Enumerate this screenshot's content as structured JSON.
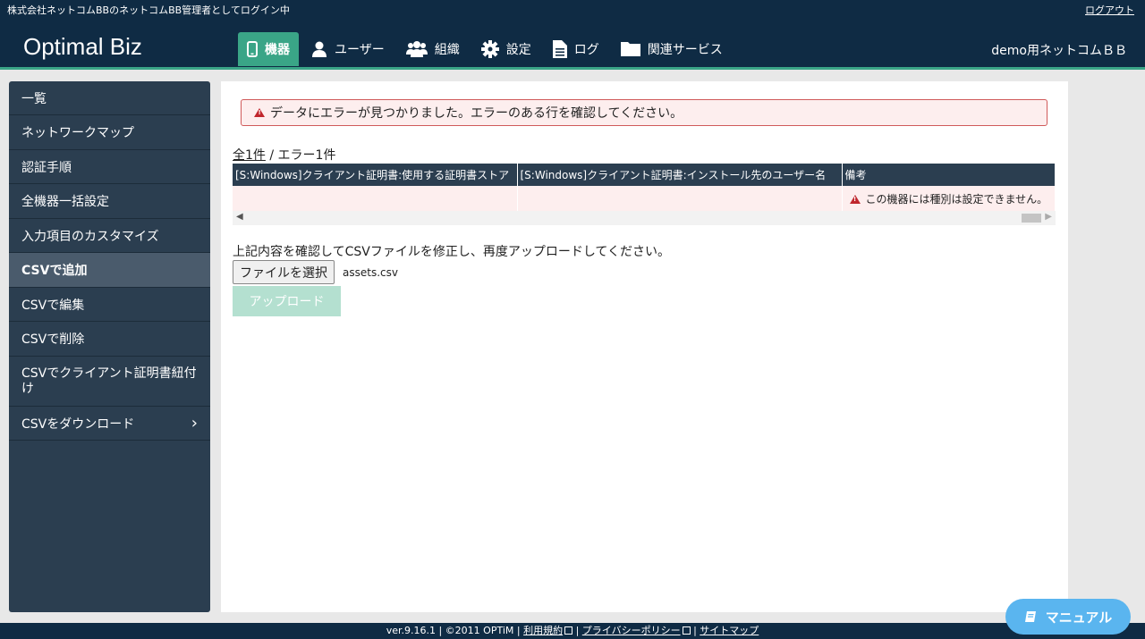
{
  "topbar": {
    "login_text": "株式会社ネットコムBBのネットコムBB管理者としてログイン中",
    "logout": "ログアウト"
  },
  "header": {
    "brand": "Optimal Biz",
    "nav": [
      {
        "label": "機器",
        "icon": "smartphone-icon",
        "active": true
      },
      {
        "label": "ユーザー",
        "icon": "user-icon"
      },
      {
        "label": "組織",
        "icon": "users-icon"
      },
      {
        "label": "設定",
        "icon": "gear-icon"
      },
      {
        "label": "ログ",
        "icon": "document-icon"
      },
      {
        "label": "関連サービス",
        "icon": "folder-icon"
      }
    ],
    "user": "demo用ネットコムＢＢ"
  },
  "sidebar": {
    "items": [
      {
        "label": "一覧"
      },
      {
        "label": "ネットワークマップ"
      },
      {
        "label": "認証手順"
      },
      {
        "label": "全機器一括設定"
      },
      {
        "label": "入力項目のカスタマイズ"
      },
      {
        "label": "CSVで追加",
        "active": true
      },
      {
        "label": "CSVで編集"
      },
      {
        "label": "CSVで削除"
      },
      {
        "label": "CSVでクライアント証明書紐付け"
      },
      {
        "label": "CSVをダウンロード",
        "chevron": true
      }
    ]
  },
  "main": {
    "alert": "データにエラーが見つかりました。エラーのある行を確認してください。",
    "count_all": "全1件",
    "count_sep": " / ",
    "count_err": "エラー1件",
    "table": {
      "headers": [
        "[S:Windows]クライアント証明書:使用する証明書ストア",
        "[S:Windows]クライアント証明書:インストール先のユーザー名",
        "備考"
      ],
      "row": [
        "",
        "",
        "この機器には種別は設定できません。"
      ]
    },
    "instruction": "上記内容を確認してCSVファイルを修正し、再度アップロードしてください。",
    "file_button": "ファイルを選択",
    "file_name": "assets.csv",
    "upload_button": "アップロード"
  },
  "footer": {
    "version": "ver.9.16.1 | ©2011 OPTiM | ",
    "terms": "利用規約",
    "privacy": "プライバシーポリシー",
    "sitemap": "サイトマップ",
    "sep": " | "
  },
  "manual": "マニュアル",
  "colors": {
    "navy": "#0f2b44",
    "green": "#3aa587",
    "sidebar": "#2b3e50",
    "error_bg": "#fdeeee",
    "error_red": "#c0262d",
    "manual_blue": "#5ab5ef"
  }
}
